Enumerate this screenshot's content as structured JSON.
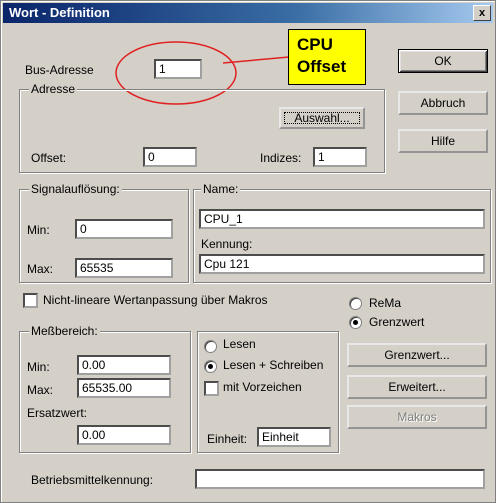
{
  "window": {
    "title": "Wort - Definition",
    "close_glyph": "x"
  },
  "annotation": {
    "line1": "CPU",
    "line2": "Offset"
  },
  "bus": {
    "label": "Bus-Adresse",
    "value": "1"
  },
  "adresse": {
    "group_title": "Adresse",
    "auswahl_button": "Auswahl...",
    "offset_label": "Offset:",
    "offset_value": "0",
    "indizes_label": "Indizes:",
    "indizes_value": "1"
  },
  "buttons": {
    "ok": "OK",
    "abbruch": "Abbruch",
    "hilfe": "Hilfe"
  },
  "signal": {
    "group_title": "Signalauflösung:",
    "min_label": "Min:",
    "min_value": "0",
    "max_label": "Max:",
    "max_value": "65535"
  },
  "name": {
    "group_title": "Name:",
    "name_value": "CPU_1",
    "kennung_label": "Kennung:",
    "kennung_value": "Cpu 121"
  },
  "nichtlinear": {
    "label": "Nicht-lineare Wertanpassung über Makros",
    "checked": false
  },
  "modus": {
    "rema_label": "ReMa",
    "grenzwert_label": "Grenzwert",
    "selected": "Grenzwert"
  },
  "messbereich": {
    "group_title": "Meßbereich:",
    "min_label": "Min:",
    "min_value": "0.00",
    "max_label": "Max:",
    "max_value": "65535.00",
    "ersatz_label": "Ersatzwert:",
    "ersatz_value": "0.00"
  },
  "zugriff": {
    "lesen_label": "Lesen",
    "lesen_schreiben_label": "Lesen + Schreiben",
    "selected": "Lesen + Schreiben",
    "vorzeichen_label": "mit Vorzeichen",
    "vorzeichen_checked": false,
    "einheit_label": "Einheit:",
    "einheit_value": "Einheit"
  },
  "side_buttons": {
    "grenzwert": "Grenzwert...",
    "erweitert": "Erweitert...",
    "makros": "Makros"
  },
  "betriebsmittel": {
    "label": "Betriebsmittelkennung:",
    "value": ""
  }
}
